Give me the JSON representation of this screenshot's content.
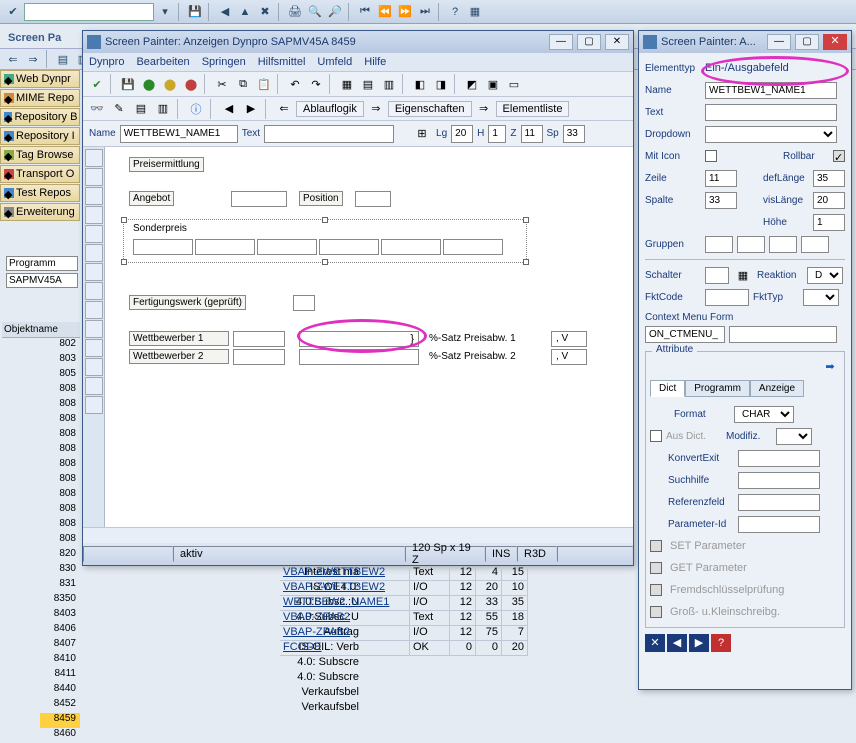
{
  "page_header": "Screen Pa",
  "left_tabs": [
    "Web Dynpr",
    "MIME Repo",
    "Repository B",
    "Repository I",
    "Tag Browse",
    "Transport O",
    "Test Repos",
    "Erweiterung"
  ],
  "prog_label": "Programm",
  "prog_value": "SAPMV45A",
  "obj_header": "Objektname",
  "obj_rows": [
    "802",
    "803",
    "805",
    "808",
    "808",
    "808",
    "808",
    "808",
    "808",
    "808",
    "808",
    "808",
    "808",
    "808",
    "820",
    "830",
    "831",
    "8350",
    "8403",
    "8406",
    "8407",
    "8410",
    "8411",
    "8440",
    "8452",
    "8459",
    "8460"
  ],
  "obj_selected": "8459",
  "sp": {
    "title": "Screen Painter: Anzeigen Dynpro SAPMV45A 8459",
    "menu": [
      "Dynpro",
      "Bearbeiten",
      "Springen",
      "Hilfsmittel",
      "Umfeld",
      "Hilfe"
    ],
    "toolbar2": {
      "ablauf": "Ablauflogik",
      "eigen": "Eigenschaften",
      "elem": "Elementliste"
    },
    "field_labels": {
      "name": "Name",
      "text": "Text",
      "lg": "Lg",
      "h": "H",
      "z": "Z",
      "sp": "Sp"
    },
    "field_values": {
      "name": "WETTBEW1_NAME1",
      "text": "",
      "lg": "20",
      "h": "1",
      "z": "11",
      "sp": "33"
    },
    "canvas": {
      "preis": "Preisermittlung",
      "angebot": "Angebot",
      "position": "Position",
      "sonder": "Sonderpreis",
      "fertig": "Fertigungswerk (geprüft)",
      "wett1": "Wettbewerber 1",
      "wett2": "Wettbewerber 2",
      "satz1": "%-Satz Preisabw. 1",
      "satz2": "%-Satz Preisabw. 2",
      "comma": ",   V",
      "brace": "}"
    },
    "status": {
      "aktiv": "aktiv",
      "pos": "120 Sp x 19 Z",
      "ins": "INS",
      "mode": "R3D"
    }
  },
  "bg_left_rows": [
    {
      "t": "Interest ma"
    },
    {
      "t": "IS-Oil 4.0:"
    },
    {
      "t": "4.0:Subsc.:U"
    },
    {
      "t": "4.0:Subsc.:U"
    },
    {
      "t": "Auftrag"
    },
    {
      "t": "IS-OIL: Verb"
    },
    {
      "t": "4.0: Subscre"
    },
    {
      "t": "4.0: Subscre"
    },
    {
      "t": "Verkaufsbel"
    },
    {
      "t": "Verkaufsbel"
    }
  ],
  "bg_table": [
    {
      "a": "VBAP-ZWETTBEW2",
      "b": "Text",
      "c": "12",
      "d": "4",
      "e": "15"
    },
    {
      "a": "VBAP-ZWETTBEW2",
      "b": "I/O",
      "c": "12",
      "d": "20",
      "e": "10"
    },
    {
      "a": "WETTBEW2_NAME1",
      "b": "I/O",
      "c": "12",
      "d": "33",
      "e": "35"
    },
    {
      "a": "VBAP-ZPAB2",
      "b": "Text",
      "c": "12",
      "d": "55",
      "e": "18"
    },
    {
      "a": "VBAP-ZPAB2",
      "b": "I/O",
      "c": "12",
      "d": "75",
      "e": "7"
    },
    {
      "a": "FCODE",
      "b": "OK",
      "c": "0",
      "d": "0",
      "e": "20"
    }
  ],
  "props": {
    "title": "Screen Painter: A...",
    "elementtype_lbl": "Elementtyp",
    "elementtype": "Ein-/Ausgabefeld",
    "name_lbl": "Name",
    "name": "WETTBEW1_NAME1",
    "text_lbl": "Text",
    "text": "",
    "dropdown_lbl": "Dropdown",
    "miticon_lbl": "Mit Icon",
    "rollbar_lbl": "Rollbar",
    "zeile_lbl": "Zeile",
    "zeile": "11",
    "deflange_lbl": "defLänge",
    "deflange": "35",
    "spalte_lbl": "Spalte",
    "spalte": "33",
    "vislange_lbl": "visLänge",
    "vislange": "20",
    "hohe_lbl": "Höhe",
    "hohe": "1",
    "gruppen_lbl": "Gruppen",
    "schalter_lbl": "Schalter",
    "reaktion_lbl": "Reaktion",
    "reaktion": "D",
    "fktcode_lbl": "FktCode",
    "fkttyp_lbl": "FktTyp",
    "ctxmenu_lbl": "Context Menu Form",
    "ctxmenu": "ON_CTMENU_",
    "attr_title": "Attribute",
    "tabs": {
      "dict": "Dict",
      "prog": "Programm",
      "anz": "Anzeige"
    },
    "format_lbl": "Format",
    "format": "CHAR",
    "ausdict_lbl": "Aus Dict.",
    "modifiz_lbl": "Modifiz.",
    "konvexit_lbl": "KonvertExit",
    "suchhilfe_lbl": "Suchhilfe",
    "reffeld_lbl": "Referenzfeld",
    "paramid_lbl": "Parameter-Id",
    "setparam_lbl": "SET Parameter",
    "getparam_lbl": "GET Parameter",
    "fremd_lbl": "Fremdschlüsselprüfung",
    "gross_lbl": "Groß- u.Kleinschreibg."
  }
}
